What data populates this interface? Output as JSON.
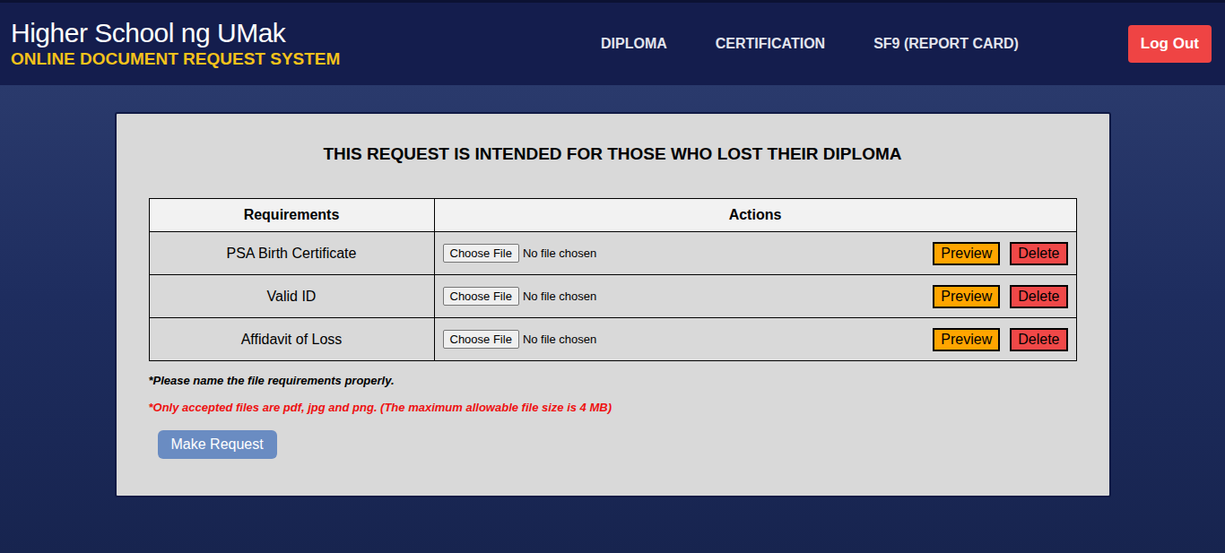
{
  "header": {
    "title": "Higher School ng UMak",
    "subtitle": "ONLINE DOCUMENT REQUEST SYSTEM"
  },
  "nav": [
    {
      "label": "DIPLOMA",
      "selected": false
    },
    {
      "label": "CERTIFICATION",
      "selected": false
    },
    {
      "label": "SF9 (REPORT CARD)",
      "selected": false
    }
  ],
  "logout": "Log Out",
  "card": {
    "title": "THIS REQUEST IS INTENDED FOR THOSE WHO LOST THEIR DIPLOMA"
  },
  "table": {
    "columns": [
      "Requirements",
      "Actions"
    ],
    "rows": [
      {
        "requirement": "PSA Birth Certificate",
        "choose": "Choose File",
        "status": "No file chosen",
        "preview": "Preview",
        "delete": "Delete"
      },
      {
        "requirement": "Valid ID",
        "choose": "Choose File",
        "status": "No file chosen",
        "preview": "Preview",
        "delete": "Delete"
      },
      {
        "requirement": "Affidavit of Loss",
        "choose": "Choose File",
        "status": "No file chosen",
        "preview": "Preview",
        "delete": "Delete"
      }
    ]
  },
  "notes": [
    "*Please name the file requirements properly.",
    "*Only accepted files are pdf, jpg and png. (The maximum allowable file size is 4 MB)"
  ],
  "submit": "Make Request"
}
